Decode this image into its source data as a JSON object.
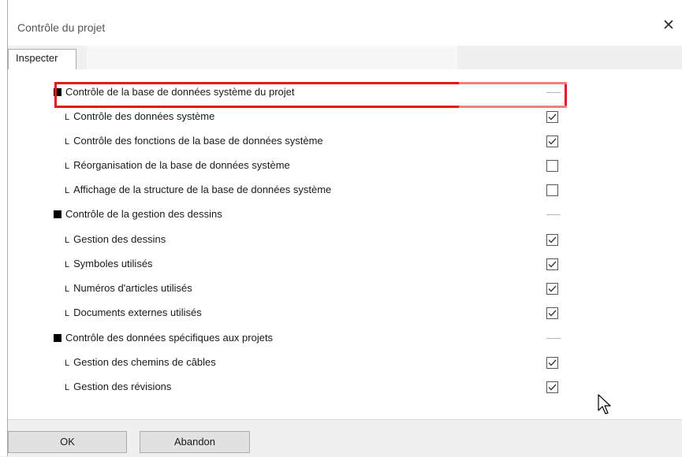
{
  "window": {
    "title": "Contrôle du projet"
  },
  "tabs": [
    {
      "label": "Inspecter"
    }
  ],
  "items": [
    {
      "type": "group",
      "label": "Contrôle de la base de données système du projet"
    },
    {
      "type": "child",
      "label": "Contrôle des données système",
      "checked": true
    },
    {
      "type": "child",
      "label": "Contrôle des fonctions de la base de données système",
      "checked": true
    },
    {
      "type": "child",
      "label": "Réorganisation de la base de données système",
      "checked": false
    },
    {
      "type": "child",
      "label": "Affichage de la structure de la base de données système",
      "checked": false
    },
    {
      "type": "group",
      "label": "Contrôle de la gestion des dessins"
    },
    {
      "type": "child",
      "label": "Gestion des dessins",
      "checked": true
    },
    {
      "type": "child",
      "label": "Symboles utilisés",
      "checked": true
    },
    {
      "type": "child",
      "label": "Numéros d'articles utilisés",
      "checked": true
    },
    {
      "type": "child",
      "label": "Documents externes utilisés",
      "checked": true
    },
    {
      "type": "group",
      "label": "Contrôle des données spécifiques aux projets"
    },
    {
      "type": "child",
      "label": "Gestion des chemins de câbles",
      "checked": true
    },
    {
      "type": "child",
      "label": "Gestion des révisions",
      "checked": true
    }
  ],
  "child_prefix": "L",
  "buttons": {
    "ok": "OK",
    "cancel": "Abandon"
  },
  "icons": {
    "close": "close-icon",
    "check": "check-icon",
    "cursor": "mouse-pointer-icon"
  },
  "colors": {
    "highlight": "#e8141c"
  }
}
